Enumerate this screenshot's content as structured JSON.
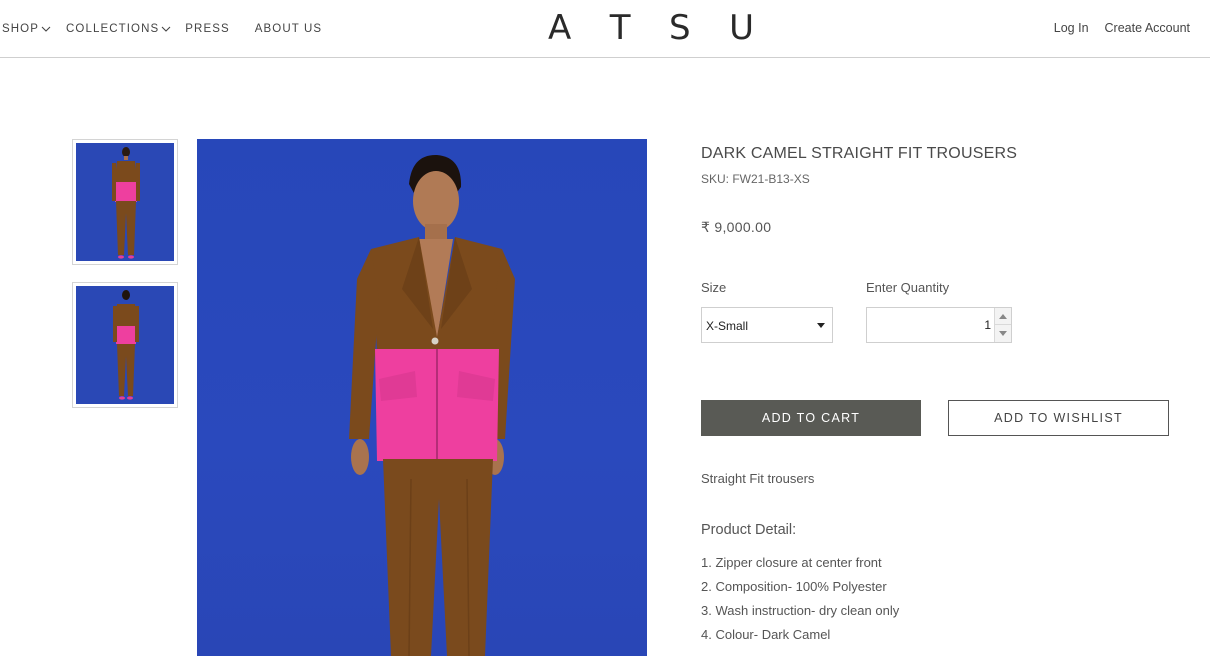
{
  "nav": {
    "items": [
      {
        "label": "SHOP",
        "has_dropdown": true
      },
      {
        "label": "COLLECTIONS",
        "has_dropdown": true
      },
      {
        "label": "PRESS",
        "has_dropdown": false
      },
      {
        "label": "ABOUT US",
        "has_dropdown": false
      }
    ]
  },
  "logo": {
    "letters": [
      "A",
      "T",
      "S",
      "U"
    ]
  },
  "account": {
    "login_label": "Log In",
    "create_label": "Create Account"
  },
  "product": {
    "title": "DARK CAMEL STRAIGHT FIT TROUSERS",
    "sku": "SKU: FW21-B13-XS",
    "price": "₹ 9,000.00",
    "size_label": "Size",
    "size_value": "X-Small",
    "quantity_label": "Enter Quantity",
    "quantity_value": "1",
    "add_to_cart_label": "ADD TO CART",
    "add_to_wishlist_label": "ADD TO WISHLIST",
    "description": "Straight Fit trousers",
    "detail_heading": "Product Detail:",
    "details": [
      "1. Zipper closure at center front",
      "2. Composition- 100% Polyester",
      "3. Wash instruction- dry clean only",
      "4. Colour- Dark Camel"
    ]
  },
  "colors": {
    "background_blue": "#2a48b5",
    "blazer_brown": "#7b4a1c",
    "pink_panel": "#ee3f9f",
    "cart_button": "#595a55"
  }
}
